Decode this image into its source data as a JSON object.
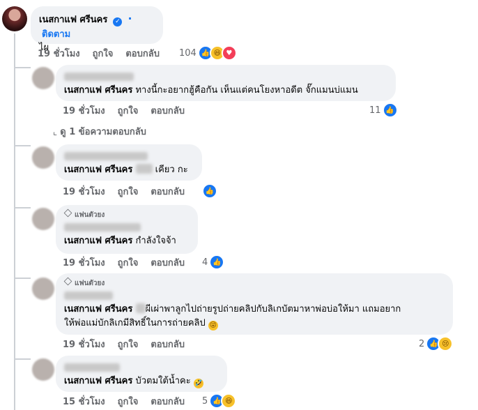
{
  "main_comment": {
    "author": "เนสกาแฟ ศรีนคร",
    "follow": "ติดตาม",
    "text": "ไผ",
    "time": "19 ชั่วโมง",
    "like": "ถูกใจ",
    "reply": "ตอบกลับ",
    "reaction_count": "104"
  },
  "replies": [
    {
      "mention": "เนสกาแฟ ศรีนคร",
      "text": " ทางนี้กะอยากฮู้คือกัน เห็นแต่คนโยงหาอดีต จั๊กแมนบ่แมน",
      "time": "19 ชั่วโมง",
      "like": "ถูกใจ",
      "reply": "ตอบกลับ",
      "reaction_count": "11"
    },
    {
      "mention": "เนสกาแฟ ศรีนคร",
      "text": "เคียว กะ",
      "time": "19 ชั่วโมง",
      "like": "ถูกใจ",
      "reply": "ตอบกลับ",
      "reaction_count": ""
    },
    {
      "badge": "แฟนตัวยง",
      "mention": "เนสกาแฟ ศรีนคร",
      "text": " กำลังใจจ้า",
      "time": "19 ชั่วโมง",
      "like": "ถูกใจ",
      "reply": "ตอบกลับ",
      "reaction_count": "4"
    },
    {
      "badge": "แฟนตัวยง",
      "mention": "เนสกาแฟ ศรีนคร",
      "text_line1": "ผีเผ่าพาลูกไปถ่ายรูปถ่ายคลิปกับลิเกบัตมาหาพ่อบ่อให้มา แถมอยาก",
      "text_line2": "ให้พ่อแม่บักลิเกมีสิทธิ์ในการถ่ายคลิป",
      "time": "19 ชั่วโมง",
      "like": "ถูกใจ",
      "reply": "ตอบกลับ",
      "reaction_count": "2"
    },
    {
      "mention": "เนสกาแฟ ศรีนคร",
      "text": " บัวตมใต้น้ำคะ",
      "time": "15 ชั่วโมง",
      "like": "ถูกใจ",
      "reply": "ตอบกลับ",
      "reaction_count": "5"
    }
  ],
  "view_more_replies": "ดู 1 ข้อความตอบกลับ",
  "icons": {
    "like": "like-icon",
    "haha": "haha-icon",
    "love": "love-icon",
    "sad": "sad-icon",
    "verified": "verified-badge-icon",
    "gem": "gem-icon"
  },
  "colors": {
    "accent": "#1877f2",
    "bubble": "#f0f2f5",
    "meta": "#65676b"
  }
}
